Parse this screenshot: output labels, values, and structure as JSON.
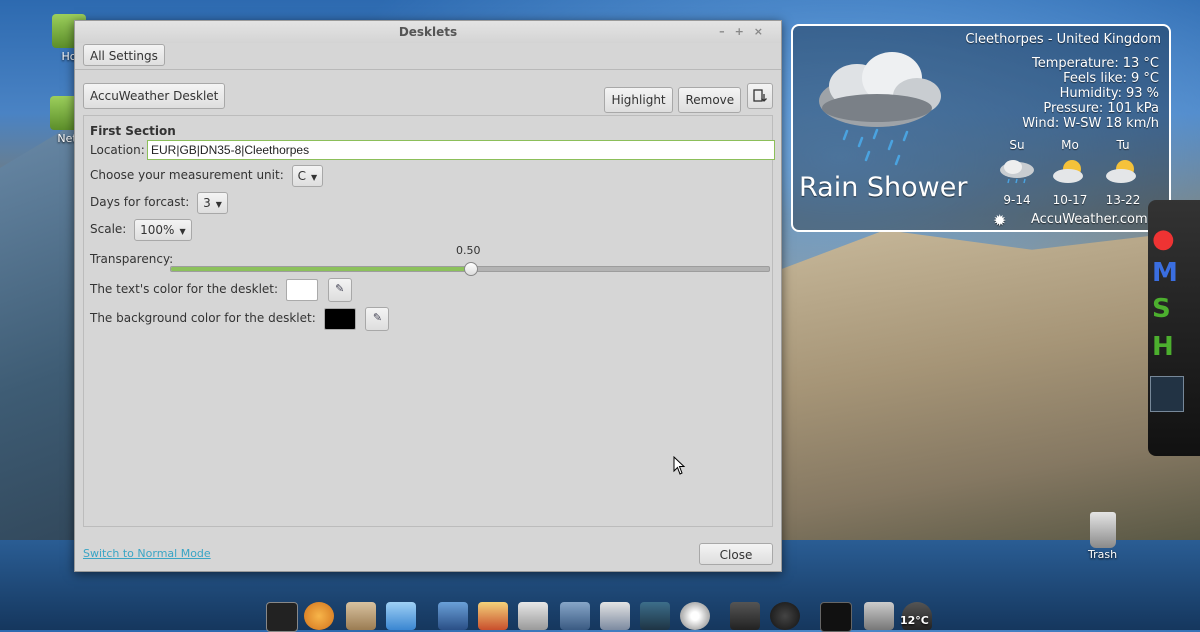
{
  "desktop": {
    "icons": [
      {
        "label": "Ho"
      },
      {
        "label": "Net"
      }
    ],
    "trash_label": "Trash"
  },
  "window": {
    "title": "Desklets",
    "controls": {
      "minimize": "–",
      "maximize": "+",
      "close": "×"
    },
    "all_settings_label": "All Settings",
    "desklet_name": "AccuWeather Desklet",
    "highlight_label": "Highlight",
    "remove_label": "Remove",
    "section": {
      "title": "First Section",
      "location_label": "Location:",
      "location_value": "EUR|GB|DN35-8|Cleethorpes",
      "unit_label": "Choose your measurement unit:",
      "unit_value": "C",
      "days_label": "Days for forcast:",
      "days_value": "3",
      "scale_label": "Scale:",
      "scale_value": "100%",
      "transparency_label": "Transparency:",
      "transparency_value": "0.50",
      "text_color_label": "The text's color for the desklet:",
      "text_color": "#ffffff",
      "bg_color_label": "The background color for the desklet:",
      "bg_color": "#000000"
    },
    "switch_mode_label": "Switch to Normal Mode",
    "close_label": "Close"
  },
  "weather": {
    "location": "Cleethorpes - United Kingdom",
    "details": [
      {
        "label": "Temperature:",
        "value": "13 °C"
      },
      {
        "label": "Feels like:",
        "value": "9 °C"
      },
      {
        "label": "Humidity:",
        "value": "93 %"
      },
      {
        "label": "Pressure:",
        "value": "101 kPa"
      },
      {
        "label": "Wind:",
        "value": "W-SW 18 km/h"
      }
    ],
    "condition": "Rain Shower",
    "forecast": [
      {
        "day": "Su",
        "range": "9-14",
        "icon": "rain-cloud-icon"
      },
      {
        "day": "Mo",
        "range": "10-17",
        "icon": "sun-cloud-icon"
      },
      {
        "day": "Tu",
        "range": "13-22",
        "icon": "sun-cloud-icon"
      }
    ],
    "provider": "AccuWeather.com"
  },
  "panel": {
    "temperature": "12°C"
  },
  "colors": {
    "accent_green": "#8cc15c",
    "link_blue": "#3aa5c5"
  }
}
